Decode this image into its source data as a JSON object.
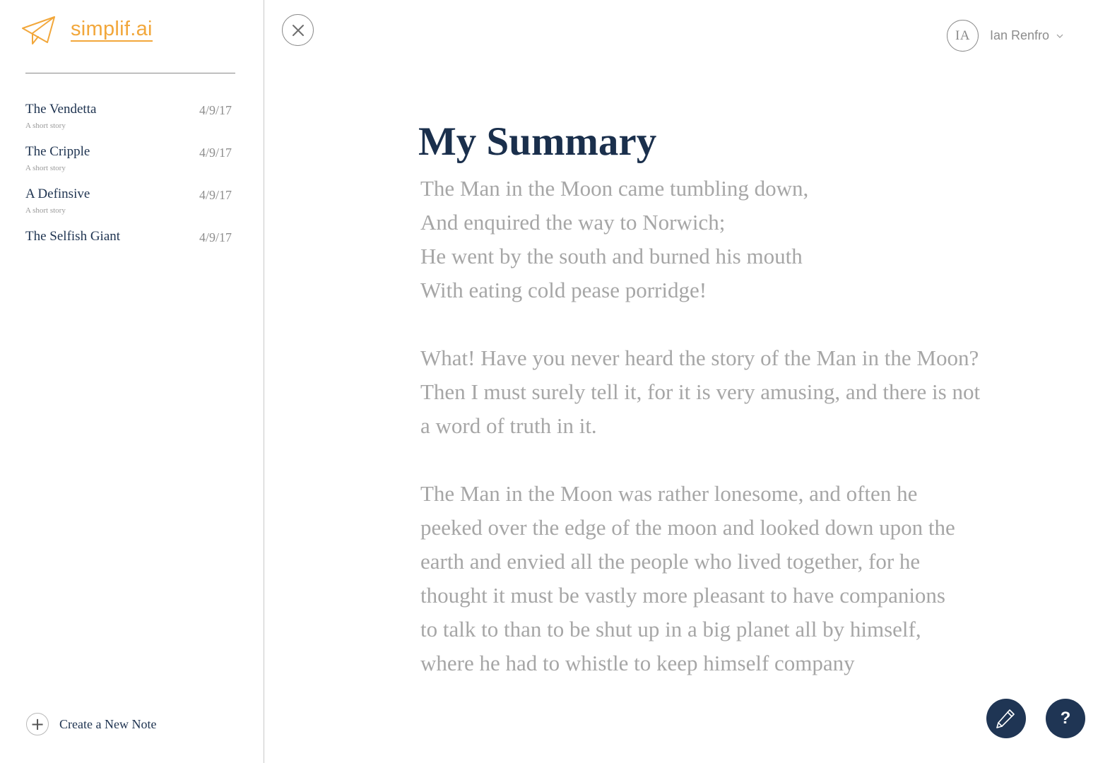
{
  "brand": {
    "name": "simplif.ai",
    "icon": "paper-plane-icon",
    "color": "#f2a73b"
  },
  "sidebar": {
    "notes": [
      {
        "title": "The Vendetta",
        "date": "4/9/17",
        "subtitle": "A short story"
      },
      {
        "title": "The Cripple",
        "date": "4/9/17",
        "subtitle": "A short story"
      },
      {
        "title": "A Definsive",
        "date": "4/9/17",
        "subtitle": "A short story"
      },
      {
        "title": "The Selfish Giant",
        "date": "4/9/17",
        "subtitle": ""
      }
    ],
    "new_note": {
      "label": "Create a New Note",
      "icon": "plus-icon"
    }
  },
  "header": {
    "close_icon": "close-icon",
    "user": {
      "initials": "IA",
      "name": "Ian Renfro",
      "dropdown_icon": "chevron-down-icon"
    }
  },
  "main": {
    "title": "My Summary",
    "paragraphs": [
      [
        "The Man in the Moon came tumbling down,",
        "And enquired the way to Norwich;",
        "He went by the south and burned his mouth",
        "With eating cold pease porridge!"
      ],
      [
        "What! Have you never heard the story of the Man in the Moon?",
        "Then I must surely tell it, for it is very amusing, and there is not",
        "a word of truth in it."
      ],
      [
        "The Man in the Moon was rather lonesome, and often he",
        "peeked over the edge of the moon and looked down upon the",
        "earth and envied all the people who lived together, for he",
        "thought it must be vastly more pleasant to have companions",
        "to talk to than to be shut up in a big planet all by himself,",
        "where he had to whistle to keep himself company"
      ]
    ]
  },
  "actions": {
    "edit_icon": "pencil-icon",
    "help_label": "?",
    "accent": "#1f3554"
  },
  "colors": {
    "title": "#1a2f4c",
    "body_text": "#a6a6a6",
    "note_title": "#1e3350"
  }
}
